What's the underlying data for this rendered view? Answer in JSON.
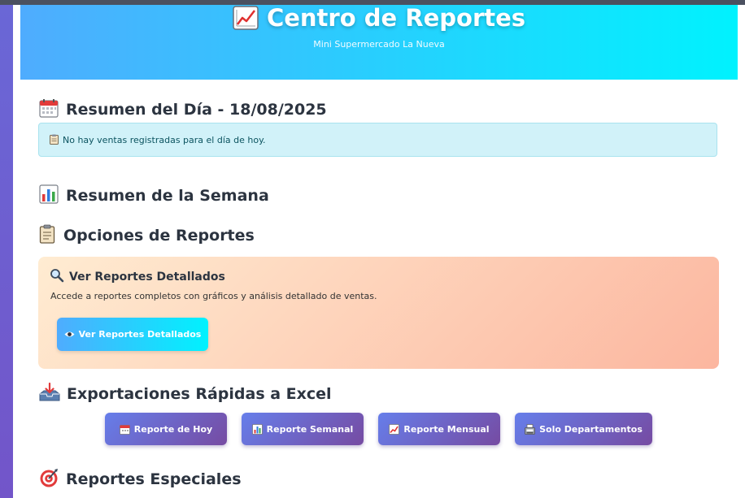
{
  "header": {
    "title": "Centro de Reportes",
    "subtitle": "Mini Supermercado La Nueva",
    "icon": "chart-increasing-icon"
  },
  "daily_summary": {
    "title": "Resumen del Día - 18/08/2025",
    "icon": "calendar-icon",
    "alert_text": "No hay ventas registradas para el día de hoy.",
    "alert_icon": "clipboard-icon"
  },
  "weekly_summary": {
    "title": "Resumen de la Semana",
    "icon": "bar-chart-icon"
  },
  "report_options": {
    "title": "Opciones de Reportes",
    "icon": "clipboard-icon",
    "card": {
      "title": "Ver Reportes Detallados",
      "icon": "magnifier-icon",
      "description": "Accede a reportes completos con gráficos y análisis detallado de ventas.",
      "button_label": "Ver Reportes Detallados",
      "button_icon": "eye-icon"
    }
  },
  "quick_exports": {
    "title": "Exportaciones Rápidas a Excel",
    "icon": "inbox-tray-icon",
    "buttons": [
      {
        "label": "Reporte de Hoy",
        "icon": "calendar-icon"
      },
      {
        "label": "Reporte Semanal",
        "icon": "bar-chart-icon"
      },
      {
        "label": "Reporte Mensual",
        "icon": "chart-increasing-icon"
      },
      {
        "label": "Solo Departamentos",
        "icon": "cash-register-icon"
      }
    ]
  },
  "special_reports": {
    "title": "Reportes Especiales",
    "icon": "target-icon"
  },
  "colors": {
    "header_gradient_start": "#4facfe",
    "header_gradient_end": "#00f2fe",
    "export_gradient_start": "#667eea",
    "export_gradient_end": "#764ba2",
    "card_gradient_start": "#ffecd2",
    "card_gradient_end": "#fcb69f",
    "alert_background": "#d1f2f9"
  }
}
